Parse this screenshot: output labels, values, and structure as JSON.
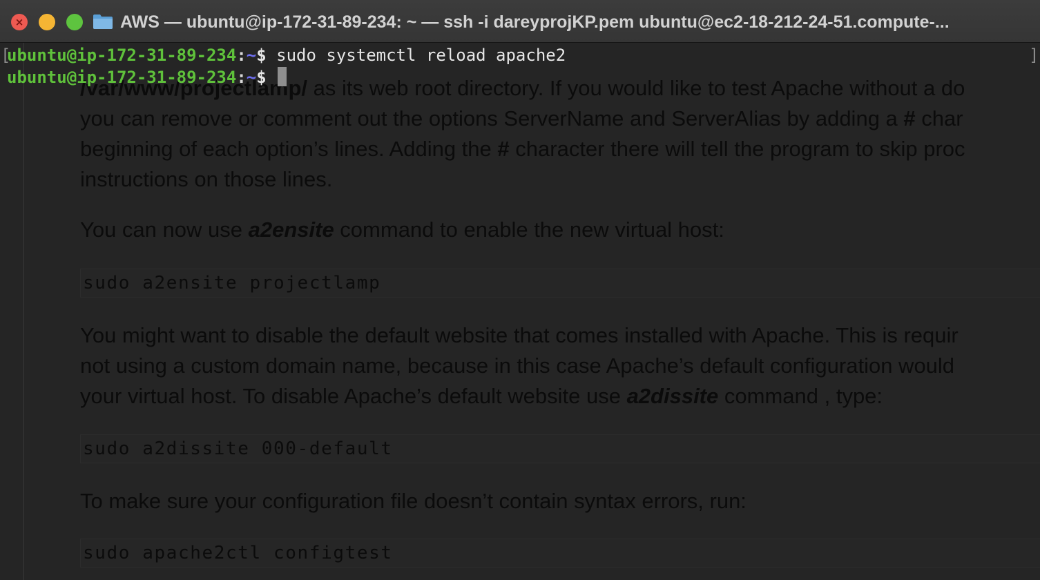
{
  "window": {
    "title": "AWS — ubuntu@ip-172-31-89-234: ~ — ssh -i dareyprojKP.pem ubuntu@ec2-18-212-24-51.compute-...",
    "traffic_lights": {
      "close_icon": "close-icon",
      "minimize_icon": "minimize-icon",
      "zoom_icon": "zoom-icon",
      "colors": {
        "close": "#ee5a52",
        "minimize": "#f5b534",
        "zoom": "#5ec43f"
      }
    },
    "folder_icon": "folder-icon"
  },
  "terminal": {
    "colors": {
      "user": "#5fc13b",
      "path": "#6f6ff0",
      "text": "#e6e6e6"
    },
    "bracket_left": "[",
    "bracket_right": "]",
    "lines": [
      {
        "user": "ubuntu@ip-172-31-89-234",
        "colon": ":",
        "path": "~",
        "dollar": "$",
        "command": " sudo systemctl reload apache2"
      },
      {
        "user": "ubuntu@ip-172-31-89-234",
        "colon": ":",
        "path": "~",
        "dollar": "$",
        "command": " "
      }
    ]
  },
  "document": {
    "para1": {
      "line0_bold": "/var/www/projectlamp/",
      "line0_text": " as its web root directory. If you would like to test Apache without a do",
      "line1_a": "you can remove or comment out the options ServerName and ServerAlias by adding a ",
      "line1_hash": "#",
      "line1_b": " char",
      "line2_a": "beginning of each option’s lines. Adding the ",
      "line2_hash": "#",
      "line2_b": " character there will tell the program to skip proc",
      "line3": "instructions on those lines."
    },
    "para2": {
      "a": "You can now use ",
      "em": "a2ensite",
      "b": " command to enable the new virtual host:"
    },
    "code1": "sudo a2ensite projectlamp",
    "para3": {
      "line1": "You might want to disable the default website that comes installed with Apache. This is requir",
      "line2": "not using a custom domain name, because in this case Apache’s default configuration would",
      "line3_a": "your virtual host. To disable Apache’s default website use ",
      "line3_em": "a2dissite",
      "line3_b": " command , type:"
    },
    "code2": "sudo a2dissite 000-default",
    "para4": "To make sure your configuration file doesn’t contain syntax errors, run:",
    "code3": "sudo apache2ctl configtest"
  }
}
